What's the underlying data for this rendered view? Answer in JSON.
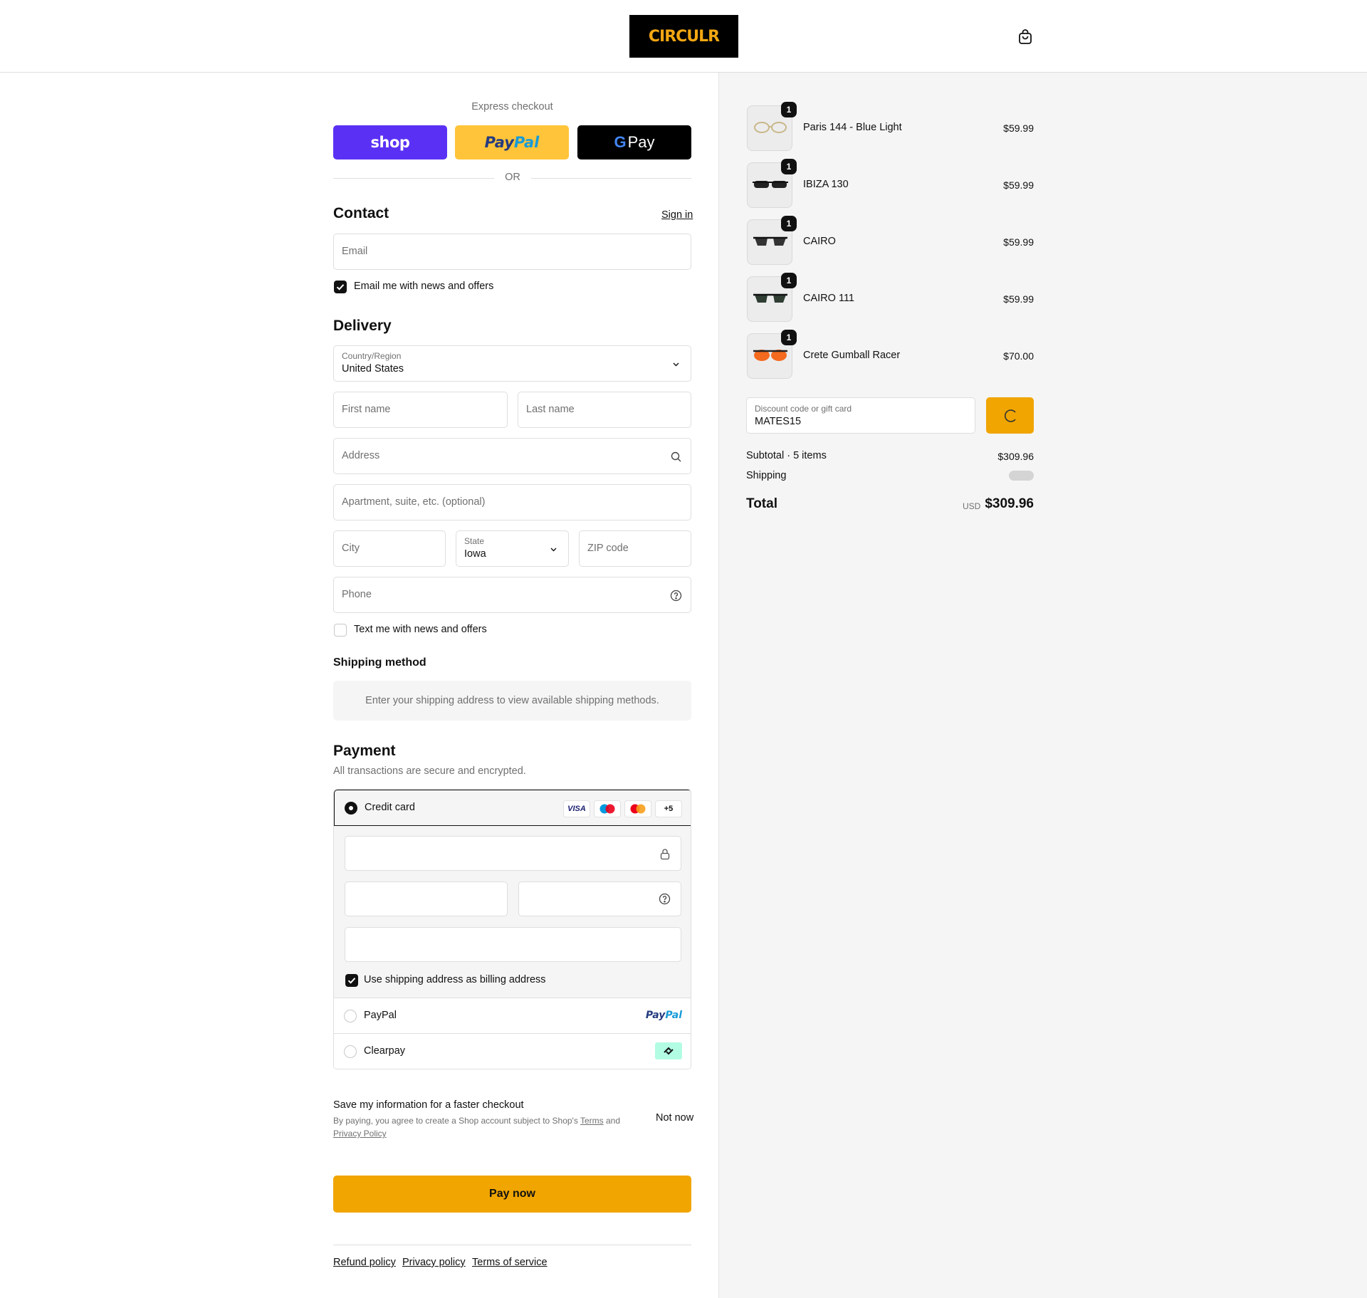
{
  "header": {
    "logo": "CIRCULR"
  },
  "express": {
    "title": "Express checkout",
    "shop_label": "shop",
    "paypal_label_a": "Pay",
    "paypal_label_b": "Pal",
    "gpay_g": "G",
    "gpay_label": "Pay",
    "or": "OR"
  },
  "contact": {
    "title": "Contact",
    "sign_in": "Sign in",
    "email_placeholder": "Email",
    "news_label": "Email me with news and offers",
    "news_checked": true
  },
  "delivery": {
    "title": "Delivery",
    "country_label": "Country/Region",
    "country_value": "United States",
    "first_name": "First name",
    "last_name": "Last name",
    "address": "Address",
    "apartment": "Apartment, suite, etc. (optional)",
    "city": "City",
    "state_label": "State",
    "state_value": "Iowa",
    "zip": "ZIP code",
    "phone": "Phone",
    "text_label": "Text me with news and offers",
    "text_checked": false
  },
  "shipping": {
    "title": "Shipping method",
    "message": "Enter your shipping address to view available shipping methods."
  },
  "payment": {
    "title": "Payment",
    "subtitle": "All transactions are secure and encrypted.",
    "credit_card": "Credit card",
    "card_logos": [
      "VISA",
      "maestro",
      "mastercard",
      "+5"
    ],
    "billing_label": "Use shipping address as billing address",
    "paypal": "PayPal",
    "paypal_logo_a": "Pay",
    "paypal_logo_b": "Pal",
    "clearpay": "Clearpay"
  },
  "save_info": {
    "title": "Save my information for a faster checkout",
    "sub_prefix": "By paying, you agree to create a Shop account subject to Shop's",
    "terms": "Terms",
    "and": "and",
    "privacy": "Privacy Policy",
    "not_now": "Not now"
  },
  "pay_now": "Pay now",
  "footer": {
    "refund": "Refund policy",
    "privacy": "Privacy policy",
    "terms": "Terms of service"
  },
  "summary": {
    "items": [
      {
        "name": "Paris 144 - Blue Light",
        "price": "$59.99",
        "qty": "1"
      },
      {
        "name": "IBIZA 130",
        "price": "$59.99",
        "qty": "1"
      },
      {
        "name": "CAIRO",
        "price": "$59.99",
        "qty": "1"
      },
      {
        "name": "CAIRO 111",
        "price": "$59.99",
        "qty": "1"
      },
      {
        "name": "Crete Gumball Racer",
        "price": "$70.00",
        "qty": "1"
      }
    ],
    "discount_label": "Discount code or gift card",
    "discount_value": "MATES15",
    "subtotal_label": "Subtotal · 5 items",
    "subtotal_value": "$309.96",
    "shipping_label": "Shipping",
    "total_label": "Total",
    "currency": "USD",
    "total_value": "$309.96"
  },
  "colors": {
    "accent": "#f0a500",
    "shop": "#5a31f4",
    "paypal": "#ffc439"
  }
}
